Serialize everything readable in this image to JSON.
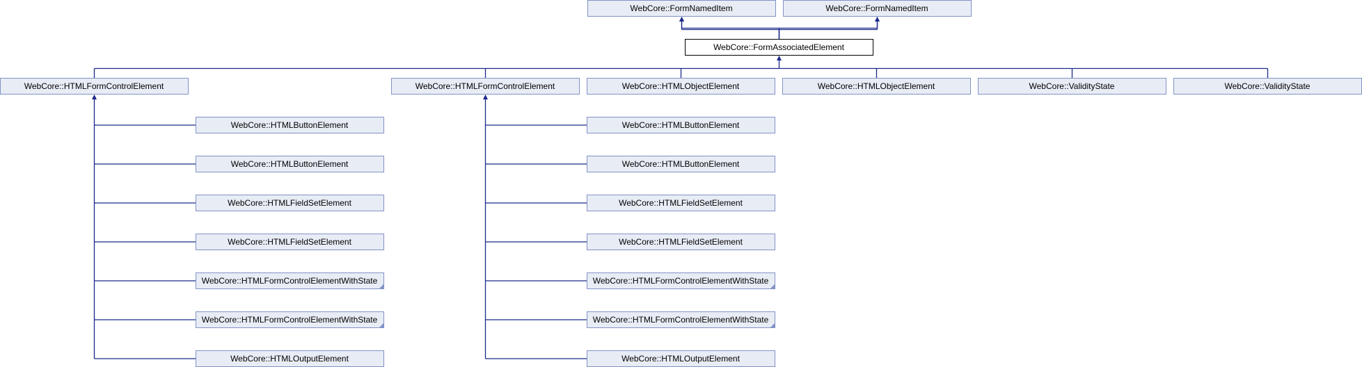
{
  "nodes": [
    {
      "id": "n1",
      "label": "WebCore::FormNamedItem"
    },
    {
      "id": "n2",
      "label": "WebCore::FormNamedItem"
    },
    {
      "id": "n3",
      "label": "WebCore::FormAssociatedElement",
      "focus": true
    },
    {
      "id": "n4",
      "label": "WebCore::HTMLFormControlElement"
    },
    {
      "id": "n5",
      "label": "WebCore::HTMLFormControlElement"
    },
    {
      "id": "n6",
      "label": "WebCore::HTMLObjectElement"
    },
    {
      "id": "n7",
      "label": "WebCore::HTMLObjectElement"
    },
    {
      "id": "n8",
      "label": "WebCore::ValidityState"
    },
    {
      "id": "n9",
      "label": "WebCore::ValidityState"
    },
    {
      "id": "a1",
      "label": "WebCore::HTMLButtonElement"
    },
    {
      "id": "a2",
      "label": "WebCore::HTMLButtonElement"
    },
    {
      "id": "a3",
      "label": "WebCore::HTMLFieldSetElement"
    },
    {
      "id": "a4",
      "label": "WebCore::HTMLFieldSetElement"
    },
    {
      "id": "a5",
      "label": "WebCore::HTMLFormControlElementWithState",
      "more": true
    },
    {
      "id": "a6",
      "label": "WebCore::HTMLFormControlElementWithState",
      "more": true
    },
    {
      "id": "a7",
      "label": "WebCore::HTMLOutputElement"
    },
    {
      "id": "b1",
      "label": "WebCore::HTMLButtonElement"
    },
    {
      "id": "b2",
      "label": "WebCore::HTMLButtonElement"
    },
    {
      "id": "b3",
      "label": "WebCore::HTMLFieldSetElement"
    },
    {
      "id": "b4",
      "label": "WebCore::HTMLFieldSetElement"
    },
    {
      "id": "b5",
      "label": "WebCore::HTMLFormControlElementWithState",
      "more": true
    },
    {
      "id": "b6",
      "label": "WebCore::HTMLFormControlElementWithState",
      "more": true
    },
    {
      "id": "b7",
      "label": "WebCore::HTMLOutputElement"
    }
  ],
  "edges": [
    {
      "from": "n3",
      "to": "n1"
    },
    {
      "from": "n3",
      "to": "n2"
    },
    {
      "from": "n4",
      "to": "n3"
    },
    {
      "from": "n5",
      "to": "n3"
    },
    {
      "from": "n6",
      "to": "n3"
    },
    {
      "from": "n7",
      "to": "n3"
    },
    {
      "from": "n8",
      "to": "n3"
    },
    {
      "from": "n9",
      "to": "n3"
    },
    {
      "from": "a1",
      "to": "n4"
    },
    {
      "from": "a2",
      "to": "n4"
    },
    {
      "from": "a3",
      "to": "n4"
    },
    {
      "from": "a4",
      "to": "n4"
    },
    {
      "from": "a5",
      "to": "n4"
    },
    {
      "from": "a6",
      "to": "n4"
    },
    {
      "from": "a7",
      "to": "n4"
    },
    {
      "from": "b1",
      "to": "n5"
    },
    {
      "from": "b2",
      "to": "n5"
    },
    {
      "from": "b3",
      "to": "n5"
    },
    {
      "from": "b4",
      "to": "n5"
    },
    {
      "from": "b5",
      "to": "n5"
    },
    {
      "from": "b6",
      "to": "n5"
    },
    {
      "from": "b7",
      "to": "n5"
    }
  ]
}
